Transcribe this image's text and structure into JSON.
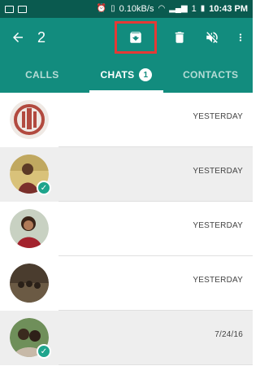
{
  "status_bar": {
    "speed": "0.10kB/s",
    "battery": "1",
    "time": "10:43 PM"
  },
  "app_bar": {
    "back_icon": "arrow-left-icon",
    "selected_count": "2",
    "actions": [
      "archive-icon",
      "delete-icon",
      "mute-icon",
      "more-vert-icon"
    ]
  },
  "tabs": [
    {
      "label": "CALLS",
      "active": false
    },
    {
      "label": "CHATS",
      "active": true,
      "badge": "1"
    },
    {
      "label": "CONTACTS",
      "active": false
    }
  ],
  "chats": [
    {
      "time": "YESTERDAY",
      "selected": false
    },
    {
      "time": "YESTERDAY",
      "selected": true
    },
    {
      "time": "YESTERDAY",
      "selected": false
    },
    {
      "time": "YESTERDAY",
      "selected": false
    },
    {
      "time": "7/24/16",
      "selected": true
    }
  ],
  "colors": {
    "primary": "#128c7e",
    "status_bar": "#0a5a4f",
    "highlight_box": "#e53935",
    "check": "#1fa58d",
    "selected_row": "#eeeeee"
  }
}
